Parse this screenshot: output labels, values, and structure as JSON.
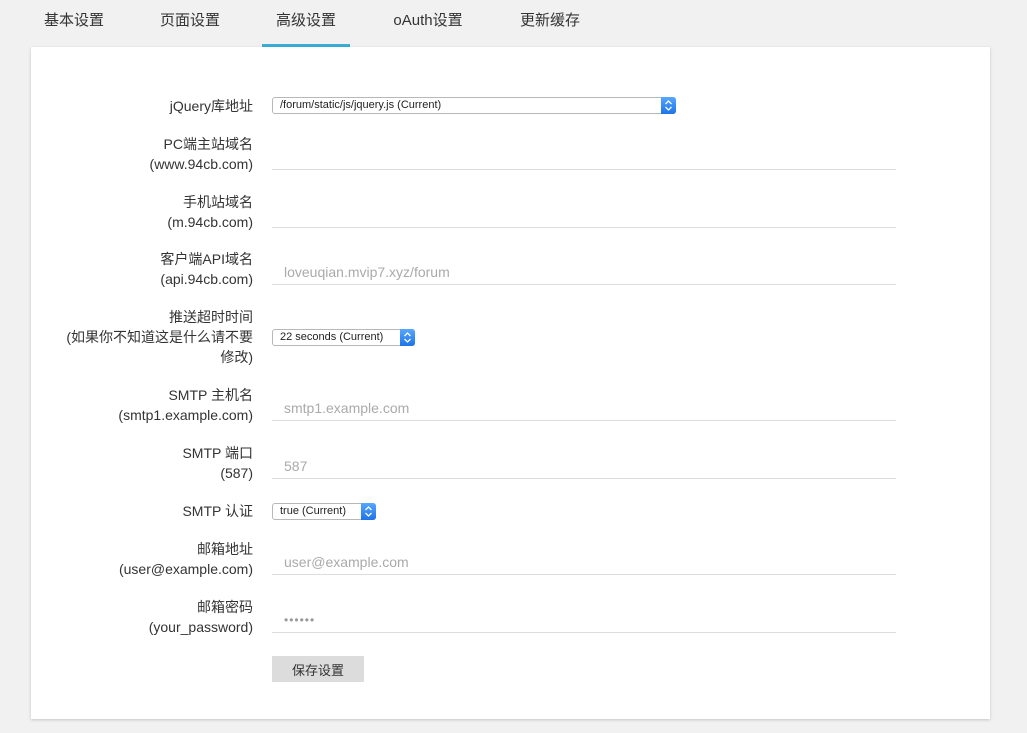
{
  "tabs": [
    {
      "label": "基本设置"
    },
    {
      "label": "页面设置"
    },
    {
      "label": "高级设置"
    },
    {
      "label": "oAuth设置"
    },
    {
      "label": "更新缓存"
    }
  ],
  "active_tab": "高级设置",
  "form": {
    "jquery": {
      "label": "jQuery库地址",
      "value": "/forum/static/js/jquery.js (Current)"
    },
    "pc_domain": {
      "label1": "PC端主站域名",
      "label2": "(www.94cb.com)",
      "value": "",
      "placeholder": ""
    },
    "mobile_domain": {
      "label1": "手机站域名",
      "label2": "(m.94cb.com)",
      "value": "",
      "placeholder": ""
    },
    "api_domain": {
      "label1": "客户端API域名",
      "label2": "(api.94cb.com)",
      "placeholder": "loveuqian.mvip7.xyz/forum"
    },
    "push_timeout": {
      "label1": "推送超时时间",
      "label2": "(如果你不知道这是什么请不要",
      "label3": "修改)",
      "value": "22 seconds (Current)"
    },
    "smtp_host": {
      "label1": "SMTP 主机名",
      "label2": "(smtp1.example.com)",
      "placeholder": "smtp1.example.com"
    },
    "smtp_port": {
      "label1": "SMTP 端口",
      "label2": "(587)",
      "placeholder": "587"
    },
    "smtp_auth": {
      "label": "SMTP 认证",
      "value": "true (Current)"
    },
    "email": {
      "label1": "邮箱地址",
      "label2": "(user@example.com)",
      "placeholder": "user@example.com"
    },
    "password": {
      "label1": "邮箱密码",
      "label2": "(your_password)",
      "value": "••••••"
    },
    "save_label": "保存设置"
  },
  "colors": {
    "accent": "#3aaed8",
    "select_arrow": "#1e73e8",
    "button_bg": "#dcdcdc"
  }
}
